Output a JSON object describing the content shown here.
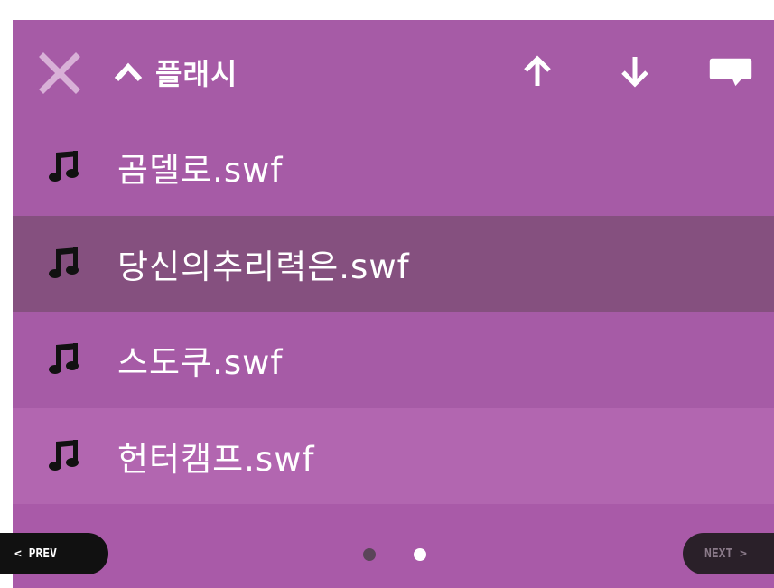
{
  "header": {
    "title": "플래시",
    "close_icon": "close-icon",
    "up_label_icon": "chevron-up-icon",
    "actions": [
      "arrow-up-icon",
      "arrow-down-icon",
      "comment-icon"
    ]
  },
  "files": [
    {
      "name": "곰델로.swf",
      "icon": "music-note-icon",
      "selected": false
    },
    {
      "name": "당신의추리력은.swf",
      "icon": "music-note-icon",
      "selected": true
    },
    {
      "name": "스도쿠.swf",
      "icon": "music-note-icon",
      "selected": false
    },
    {
      "name": "헌터캠프.swf",
      "icon": "music-note-icon",
      "selected": false
    }
  ],
  "pager": {
    "prev_label": "< PREV",
    "next_label": "NEXT >",
    "pages": 2,
    "current_page": 2
  },
  "colors": {
    "background": "#a95aa8",
    "selected_row": "#85507f",
    "text": "#ffffff"
  }
}
